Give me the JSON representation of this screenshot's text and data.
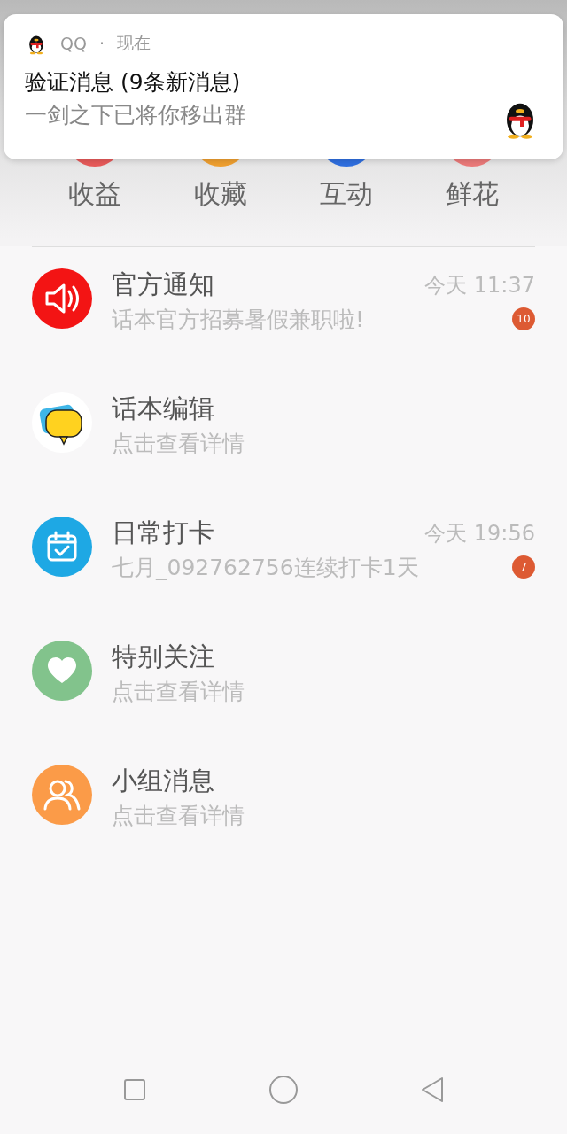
{
  "notification": {
    "app": "QQ",
    "separator": "·",
    "time": "现在",
    "title": "验证消息 (9条新消息)",
    "body": "一剑之下已将你移出群"
  },
  "categories": [
    {
      "label": "收益",
      "color": "#e85a5a"
    },
    {
      "label": "收藏",
      "color": "#f0a030"
    },
    {
      "label": "互动",
      "color": "#2f6fe0"
    },
    {
      "label": "鲜花",
      "color": "#ec7a7a"
    }
  ],
  "messages": [
    {
      "kind": "speaker",
      "color": "#f31414",
      "title": "官方通知",
      "time": "今天 11:37",
      "subtitle": "话本官方招募暑假兼职啦!",
      "badge": "10"
    },
    {
      "kind": "bubble",
      "color": "#ffffff",
      "title": "话本编辑",
      "subtitle": "点击查看详情"
    },
    {
      "kind": "calendar",
      "color": "#1ea8e4",
      "title": "日常打卡",
      "time": "今天 19:56",
      "subtitle": "七月_092762756连续打卡1天",
      "badge": "7"
    },
    {
      "kind": "heart",
      "color": "#82c38c",
      "title": "特别关注",
      "subtitle": "点击查看详情"
    },
    {
      "kind": "people",
      "color": "#fb9b48",
      "title": "小组消息",
      "subtitle": "点击查看详情"
    }
  ]
}
